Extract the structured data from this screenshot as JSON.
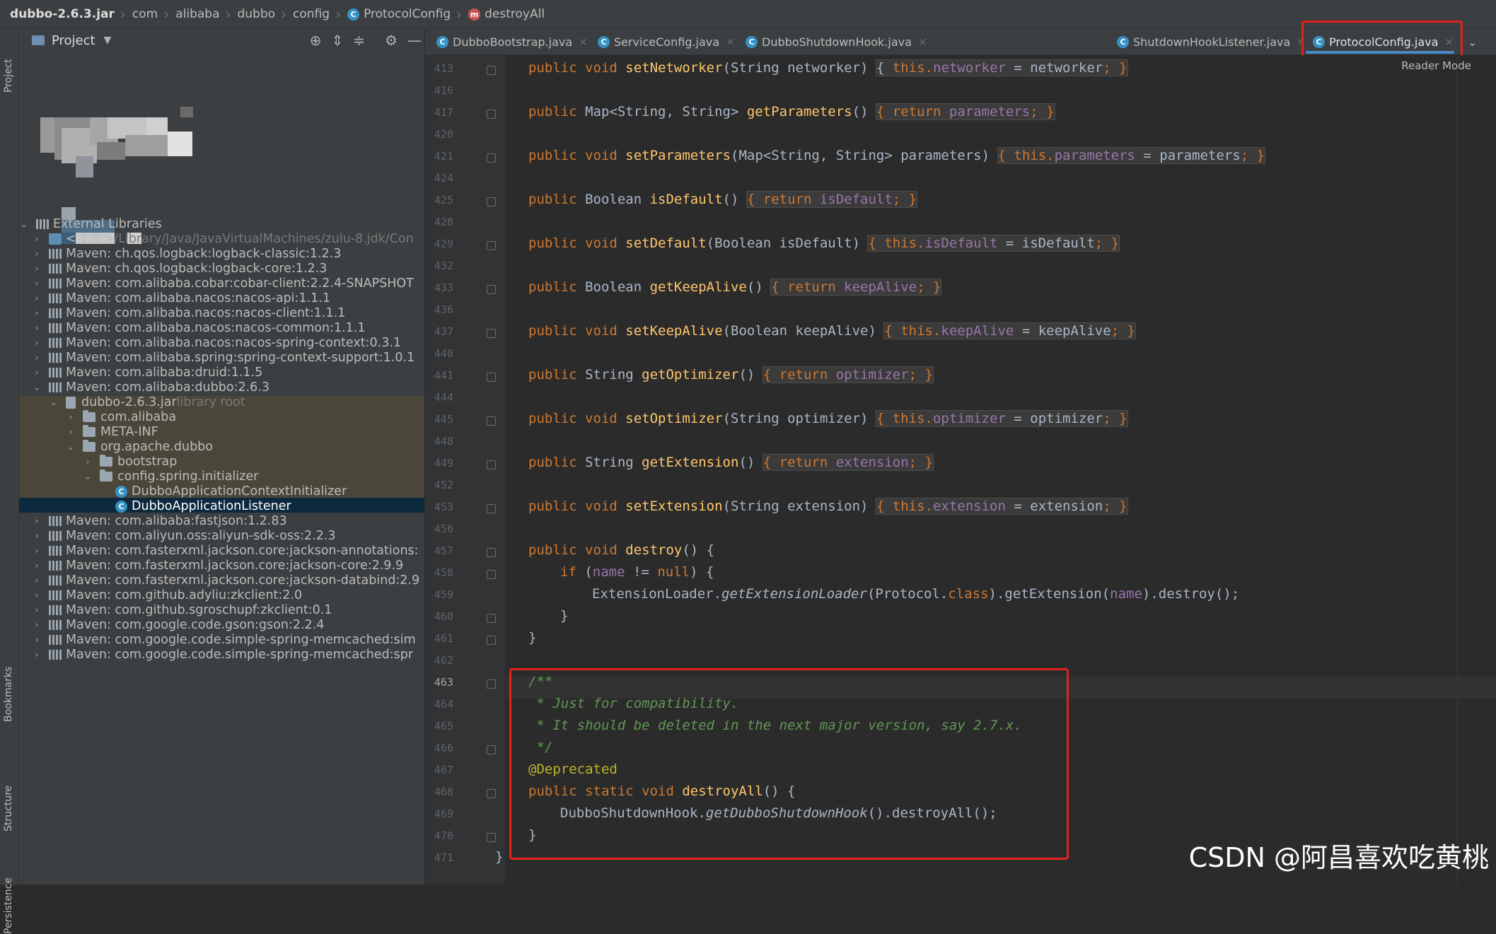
{
  "breadcrumb": {
    "items": [
      "dubbo-2.6.3.jar",
      "com",
      "alibaba",
      "dubbo",
      "config",
      "ProtocolConfig",
      "destroyAll"
    ]
  },
  "left_stripe": {
    "project": "Project",
    "bookmarks": "Bookmarks",
    "structure": "Structure",
    "persistence": "Persistence"
  },
  "project_panel": {
    "title": "Project",
    "tree": [
      {
        "text": "External Libraries",
        "extra": ""
      },
      {
        "text": "< 1.8 >",
        "extra": " /Library/Java/JavaVirtualMachines/zulu-8.jdk/Con"
      },
      {
        "text": "Maven: ch.qos.logback:logback-classic:1.2.3",
        "extra": ""
      },
      {
        "text": "Maven: ch.qos.logback:logback-core:1.2.3",
        "extra": ""
      },
      {
        "text": "Maven: com.alibaba.cobar:cobar-client:2.2.4-SNAPSHOT",
        "extra": ""
      },
      {
        "text": "Maven: com.alibaba.nacos:nacos-api:1.1.1",
        "extra": ""
      },
      {
        "text": "Maven: com.alibaba.nacos:nacos-client:1.1.1",
        "extra": ""
      },
      {
        "text": "Maven: com.alibaba.nacos:nacos-common:1.1.1",
        "extra": ""
      },
      {
        "text": "Maven: com.alibaba.nacos:nacos-spring-context:0.3.1",
        "extra": ""
      },
      {
        "text": "Maven: com.alibaba.spring:spring-context-support:1.0.1",
        "extra": ""
      },
      {
        "text": "Maven: com.alibaba:druid:1.1.5",
        "extra": ""
      },
      {
        "text": "Maven: com.alibaba:dubbo:2.6.3",
        "extra": ""
      },
      {
        "text": "dubbo-2.6.3.jar",
        "extra": " library root"
      },
      {
        "text": "com.alibaba",
        "extra": ""
      },
      {
        "text": "META-INF",
        "extra": ""
      },
      {
        "text": "org.apache.dubbo",
        "extra": ""
      },
      {
        "text": "bootstrap",
        "extra": ""
      },
      {
        "text": "config.spring.initializer",
        "extra": ""
      },
      {
        "text": "DubboApplicationContextInitializer",
        "extra": ""
      },
      {
        "text": "DubboApplicationListener",
        "extra": ""
      },
      {
        "text": "Maven: com.alibaba:fastjson:1.2.83",
        "extra": ""
      },
      {
        "text": "Maven: com.aliyun.oss:aliyun-sdk-oss:2.2.3",
        "extra": ""
      },
      {
        "text": "Maven: com.fasterxml.jackson.core:jackson-annotations:",
        "extra": ""
      },
      {
        "text": "Maven: com.fasterxml.jackson.core:jackson-core:2.9.9",
        "extra": ""
      },
      {
        "text": "Maven: com.fasterxml.jackson.core:jackson-databind:2.9",
        "extra": ""
      },
      {
        "text": "Maven: com.github.adyliu:zkclient:2.0",
        "extra": ""
      },
      {
        "text": "Maven: com.github.sgroschupf:zkclient:0.1",
        "extra": ""
      },
      {
        "text": "Maven: com.google.code.gson:gson:2.2.4",
        "extra": ""
      },
      {
        "text": "Maven: com.google.code.simple-spring-memcached:sim",
        "extra": ""
      },
      {
        "text": "Maven: com.google.code.simple-spring-memcached:spr",
        "extra": ""
      }
    ]
  },
  "tabs": [
    {
      "label": "DubboBootstrap.java"
    },
    {
      "label": "ServiceConfig.java"
    },
    {
      "label": "DubboShutdownHook.java"
    },
    {
      "label": "ShutdownHookListener.java"
    },
    {
      "label": "ProtocolConfig.java"
    }
  ],
  "reader_mode": "Reader Mode",
  "line_numbers": [
    "413",
    "416",
    "417",
    "420",
    "421",
    "424",
    "425",
    "428",
    "429",
    "432",
    "433",
    "436",
    "437",
    "440",
    "441",
    "444",
    "445",
    "448",
    "449",
    "452",
    "453",
    "456",
    "457",
    "458",
    "459",
    "460",
    "461",
    "462",
    "463",
    "464",
    "465",
    "466",
    "467",
    "468",
    "469",
    "470",
    "471"
  ],
  "code": {
    "l413": {
      "a": "public void ",
      "f": "setNetworker",
      "b": "(String networker) ",
      "c": "{ ",
      "d": "this.",
      "e": "networker",
      "g": " = networker",
      "h": "; }"
    },
    "l417": {
      "a": "public ",
      "b": "Map<String, String> ",
      "f": "getParameters",
      "c": "() ",
      "d": "{ return ",
      "e": "parameters",
      "h": "; }"
    },
    "l421": {
      "a": "public void ",
      "f": "setParameters",
      "b": "(Map<String, String> parameters) ",
      "d": "{ this.",
      "e": "parameters",
      "g": " = parameters",
      "h": "; }"
    },
    "l425": {
      "a": "public ",
      "b": "Boolean ",
      "f": "isDefault",
      "c": "() ",
      "d": "{ return ",
      "e": "isDefault",
      "h": "; }"
    },
    "l429": {
      "a": "public void ",
      "f": "setDefault",
      "b": "(Boolean isDefault) ",
      "d": "{ this.",
      "e": "isDefault",
      "g": " = isDefault",
      "h": "; }"
    },
    "l433": {
      "a": "public ",
      "b": "Boolean ",
      "f": "getKeepAlive",
      "c": "() ",
      "d": "{ return ",
      "e": "keepAlive",
      "h": "; }"
    },
    "l437": {
      "a": "public void ",
      "f": "setKeepAlive",
      "b": "(Boolean keepAlive) ",
      "d": "{ this.",
      "e": "keepAlive",
      "g": " = keepAlive",
      "h": "; }"
    },
    "l441": {
      "a": "public ",
      "b": "String ",
      "f": "getOptimizer",
      "c": "() ",
      "d": "{ return ",
      "e": "optimizer",
      "h": "; }"
    },
    "l445": {
      "a": "public void ",
      "f": "setOptimizer",
      "b": "(String optimizer) ",
      "d": "{ this.",
      "e": "optimizer",
      "g": " = optimizer",
      "h": "; }"
    },
    "l449": {
      "a": "public ",
      "b": "String ",
      "f": "getExtension",
      "c": "() ",
      "d": "{ return ",
      "e": "extension",
      "h": "; }"
    },
    "l453": {
      "a": "public void ",
      "f": "setExtension",
      "b": "(String extension) ",
      "d": "{ this.",
      "e": "extension",
      "g": " = extension",
      "h": "; }"
    },
    "l457": {
      "a": "public void ",
      "f": "destroy",
      "b": "() {"
    },
    "l458": {
      "a": "if ",
      "b": "(",
      "e": "name",
      "c": " != ",
      "d": "null",
      "g": ") {"
    },
    "l459": {
      "a": "ExtensionLoader.",
      "f": "getExtensionLoader",
      "b": "(Protocol.",
      "d": "class",
      "c": ").getExtension(",
      "e": "name",
      "g": ").destroy();"
    },
    "l460": "}",
    "l461": "}",
    "l463": "/**",
    "l464": " * Just for compatibility.",
    "l465": " * It should be deleted in the next major version, say 2.7.x.",
    "l466": " */",
    "l467": "@Deprecated",
    "l468": {
      "a": "public static void ",
      "f": "destroyAll",
      "b": "() {"
    },
    "l469": {
      "a": "DubboShutdownHook.",
      "f": "getDubboShutdownHook",
      "b": "().destroyAll();"
    },
    "l470": "}",
    "l471": "}"
  },
  "watermark": "CSDN @阿昌喜欢吃黄桃",
  "colors": {
    "keyword": "#cc7832",
    "method": "#ffc66d",
    "field": "#9876aa",
    "comment": "#629755",
    "annotation": "#bbb529",
    "highlight_box": "#e2231a"
  }
}
